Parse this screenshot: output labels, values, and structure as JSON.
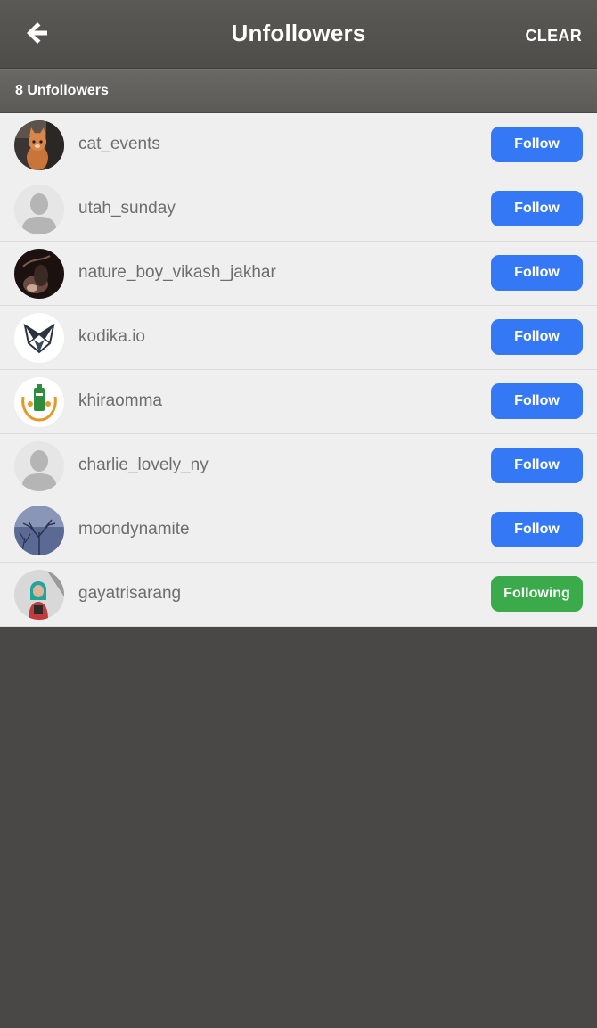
{
  "header": {
    "title": "Unfollowers",
    "clear_label": "CLEAR",
    "back_icon": "arrow-left-icon"
  },
  "subheader": {
    "count_label": "8 Unfollowers"
  },
  "colors": {
    "follow": "#3578f6",
    "following": "#3aaa4b",
    "header": "#55534f",
    "list_bg": "#efefef"
  },
  "users": [
    {
      "username": "cat_events",
      "button": "Follow",
      "state": "follow",
      "avatar": "cat-photo"
    },
    {
      "username": "utah_sunday",
      "button": "Follow",
      "state": "follow",
      "avatar": "default-person"
    },
    {
      "username": "nature_boy_vikash_jakhar",
      "button": "Follow",
      "state": "follow",
      "avatar": "dark-photo"
    },
    {
      "username": "kodika.io",
      "button": "Follow",
      "state": "follow",
      "avatar": "fox-logo"
    },
    {
      "username": "khiraomma",
      "button": "Follow",
      "state": "follow",
      "avatar": "emblem-logo"
    },
    {
      "username": "charlie_lovely_ny",
      "button": "Follow",
      "state": "follow",
      "avatar": "default-person"
    },
    {
      "username": "moondynamite",
      "button": "Follow",
      "state": "follow",
      "avatar": "winter-tree-photo"
    },
    {
      "username": "gayatrisarang",
      "button": "Following",
      "state": "following",
      "avatar": "person-photo"
    }
  ]
}
